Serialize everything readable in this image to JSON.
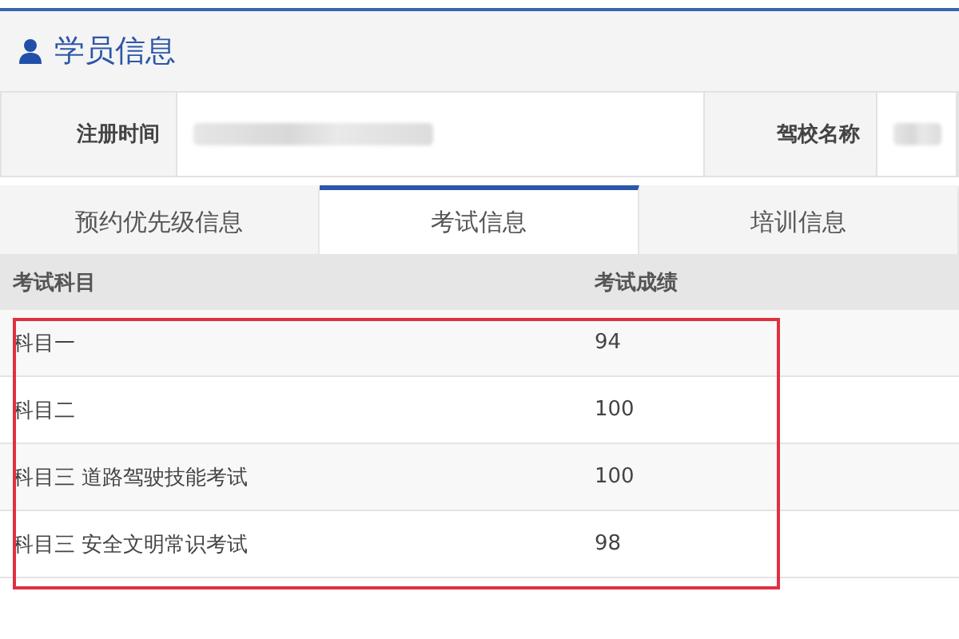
{
  "header": {
    "title": "学员信息"
  },
  "info_fields": [
    {
      "label": "注册时间",
      "redacted": true
    },
    {
      "label": "驾校名称",
      "redacted": true
    }
  ],
  "tabs": [
    {
      "label": "预约优先级信息",
      "selected": false
    },
    {
      "label": "考试信息",
      "selected": true
    },
    {
      "label": "培训信息",
      "selected": false
    }
  ],
  "table": {
    "columns": [
      "考试科目",
      "考试成绩"
    ],
    "rows": [
      [
        "科目一",
        "94"
      ],
      [
        "科目二",
        "100"
      ],
      [
        "科目三 道路驾驶技能考试",
        "100"
      ],
      [
        "科目三 安全文明常识考试",
        "98"
      ]
    ],
    "highlighted": true
  }
}
